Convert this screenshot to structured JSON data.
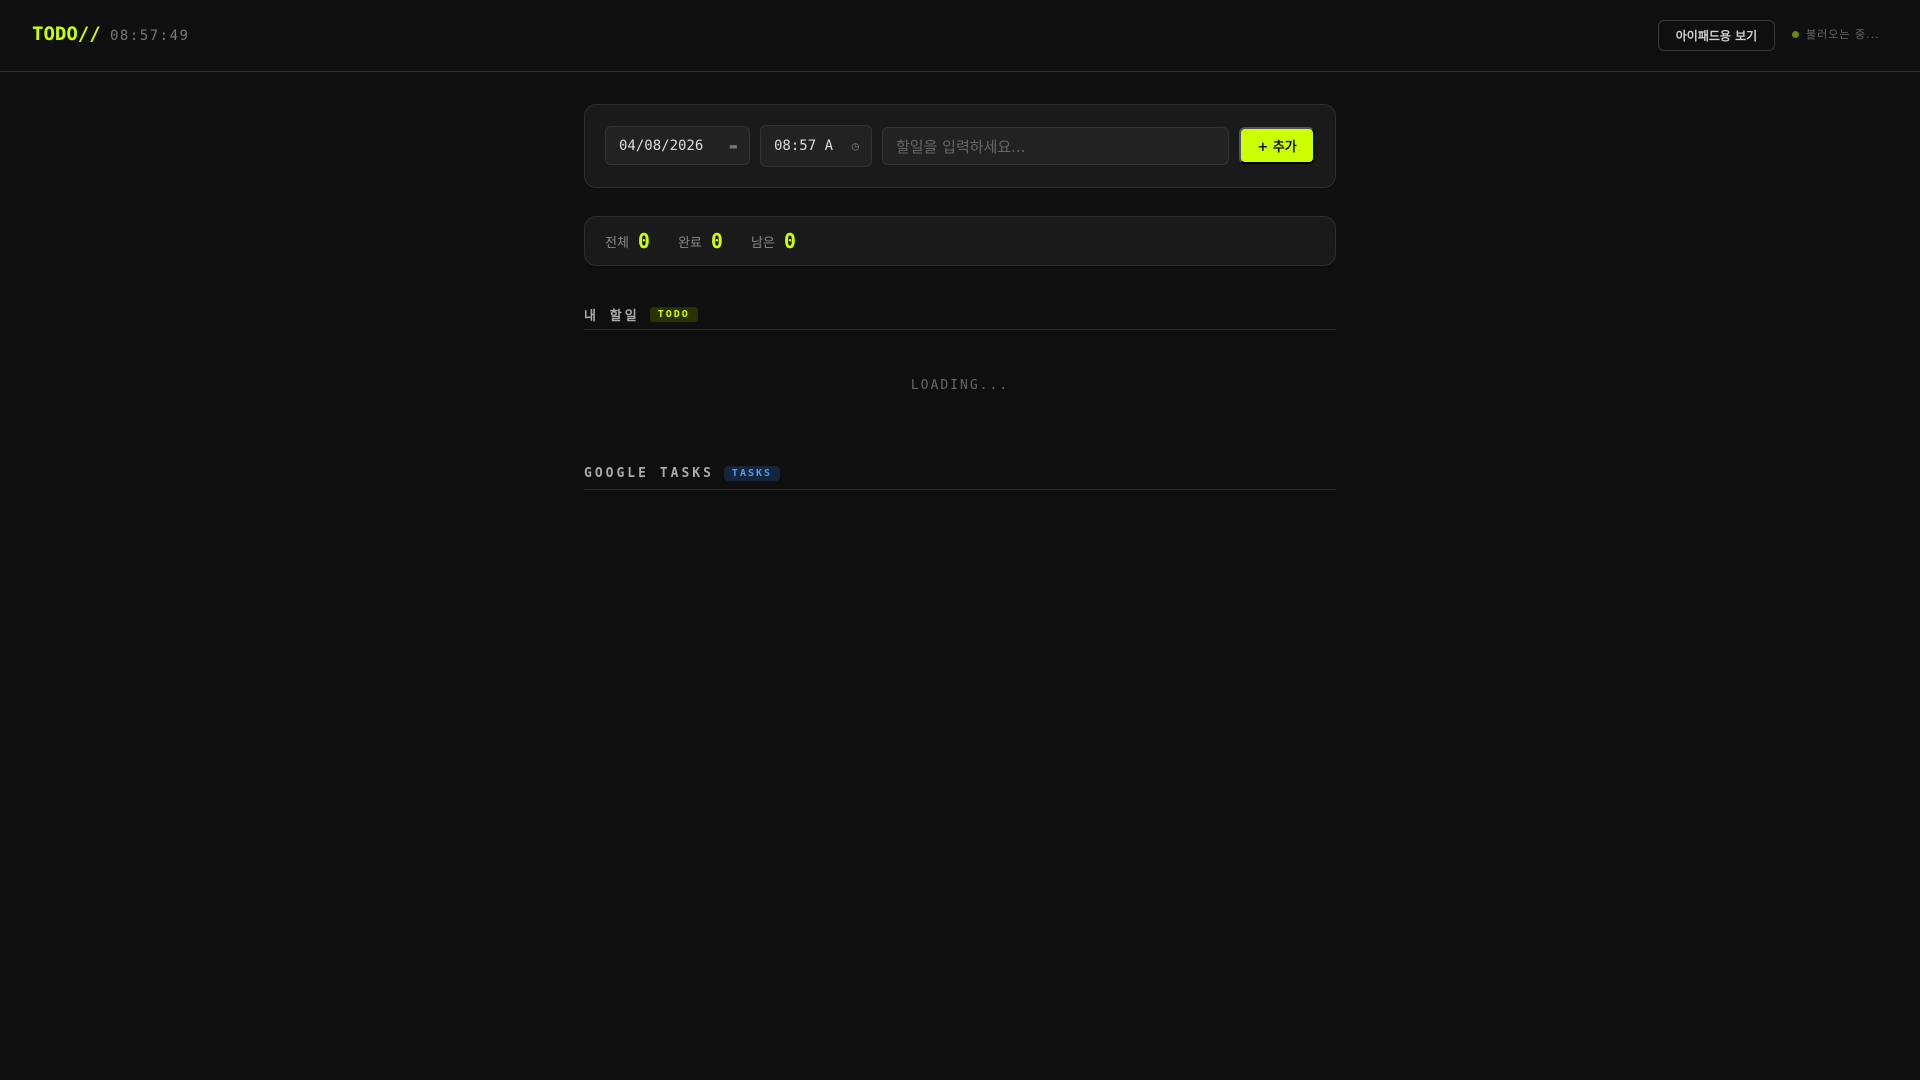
{
  "header": {
    "logo": "TODO//",
    "clock": "08:57:49",
    "ipad_button": "아이패드용 보기",
    "status": "불러오는 중..."
  },
  "form": {
    "date": "04/08/2026",
    "time": "08:57 A",
    "placeholder": "할일을 입력하세요...",
    "add_button": "+ 추가"
  },
  "stats": [
    {
      "label": "전체",
      "value": "0"
    },
    {
      "label": "완료",
      "value": "0"
    },
    {
      "label": "남은",
      "value": "0"
    }
  ],
  "sections": {
    "my_todo": {
      "title": "내 할일",
      "badge": "TODO",
      "loading": "LOADING..."
    },
    "google": {
      "title": "GOOGLE TASKS",
      "badge": "TASKS"
    }
  },
  "colors": {
    "accent": "#ccff00",
    "tasks": "#4a9eff",
    "bg": "#0f0f0f"
  }
}
